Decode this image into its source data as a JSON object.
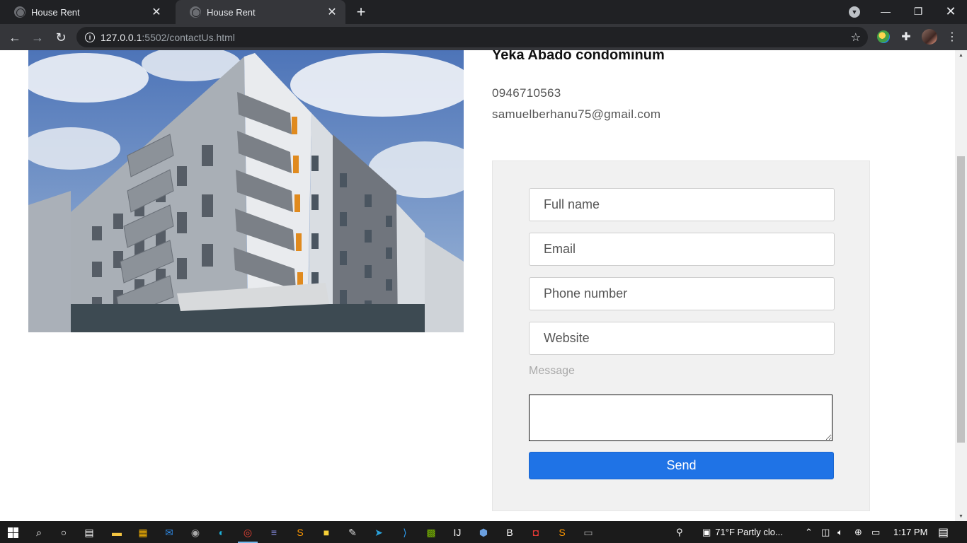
{
  "browser": {
    "tabs": [
      {
        "title": "House Rent",
        "active": false
      },
      {
        "title": "House Rent",
        "active": true
      }
    ],
    "url_host": "127.0.0.1",
    "url_rest": ":5502/contactUs.html"
  },
  "contact": {
    "title": "Yeka Abado condominum",
    "phone": "0946710563",
    "email": "samuelberhanu75@gmail.com"
  },
  "form": {
    "full_name_placeholder": "Full name",
    "email_placeholder": "Email",
    "phone_placeholder": "Phone number",
    "website_placeholder": "Website",
    "message_label": "Message",
    "send_label": "Send"
  },
  "taskbar": {
    "weather": "71°F  Partly clo...",
    "time": "1:17 PM"
  },
  "colors": {
    "send_button": "#1f73e6",
    "form_panel": "#f1f1f1",
    "browser_chrome": "#35363a"
  }
}
